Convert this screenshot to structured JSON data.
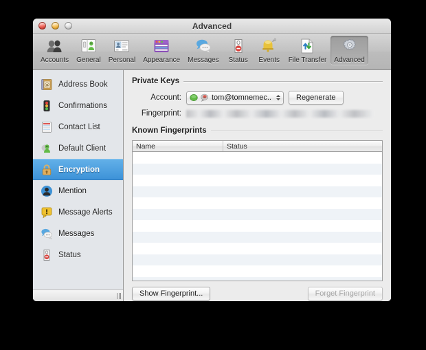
{
  "window": {
    "title": "Advanced",
    "controls": [
      {
        "name": "close-button",
        "label": "Close"
      },
      {
        "name": "minimize-button",
        "label": "Minimize"
      },
      {
        "name": "zoom-button",
        "label": "Zoom"
      }
    ]
  },
  "toolbar": {
    "items": [
      {
        "label": "Accounts",
        "icon": "accounts-icon",
        "selected": false
      },
      {
        "label": "General",
        "icon": "general-icon",
        "selected": false
      },
      {
        "label": "Personal",
        "icon": "personal-icon",
        "selected": false
      },
      {
        "label": "Appearance",
        "icon": "appearance-icon",
        "selected": false
      },
      {
        "label": "Messages",
        "icon": "messages-icon",
        "selected": false
      },
      {
        "label": "Status",
        "icon": "status-icon",
        "selected": false
      },
      {
        "label": "Events",
        "icon": "events-icon",
        "selected": false
      },
      {
        "label": "File Transfer",
        "icon": "file-transfer-icon",
        "selected": false
      },
      {
        "label": "Advanced",
        "icon": "advanced-gear-icon",
        "selected": true
      }
    ]
  },
  "sidebar": {
    "items": [
      {
        "label": "Address Book",
        "icon": "address-book-icon",
        "selected": false
      },
      {
        "label": "Confirmations",
        "icon": "traffic-light-icon",
        "selected": false
      },
      {
        "label": "Contact List",
        "icon": "contact-list-icon",
        "selected": false
      },
      {
        "label": "Default Client",
        "icon": "default-client-icon",
        "selected": false
      },
      {
        "label": "Encryption",
        "icon": "lock-icon",
        "selected": true
      },
      {
        "label": "Mention",
        "icon": "mention-icon",
        "selected": false
      },
      {
        "label": "Message Alerts",
        "icon": "message-alerts-icon",
        "selected": false
      },
      {
        "label": "Messages",
        "icon": "messages-bubble-icon",
        "selected": false
      },
      {
        "label": "Status",
        "icon": "status-doorhanger-icon",
        "selected": false
      }
    ]
  },
  "main": {
    "private_keys": {
      "title": "Private Keys",
      "account_label": "Account:",
      "account_value": "tom@tomnemec....",
      "regenerate_label": "Regenerate",
      "fingerprint_label": "Fingerprint:",
      "fingerprint_value": ""
    },
    "known_fingerprints": {
      "title": "Known Fingerprints",
      "columns": [
        "Name",
        "Status"
      ],
      "rows": [],
      "empty_row_count": 12
    },
    "buttons": {
      "show_fingerprint": "Show Fingerprint...",
      "forget_fingerprint": "Forget Fingerprint",
      "forget_disabled": true
    }
  },
  "colors": {
    "selection_blue": "#3d92d8",
    "window_bg": "#ececec",
    "sidebar_bg": "#e3e6ea",
    "row_alt": "#eff3f7",
    "desktop": "#000000"
  }
}
